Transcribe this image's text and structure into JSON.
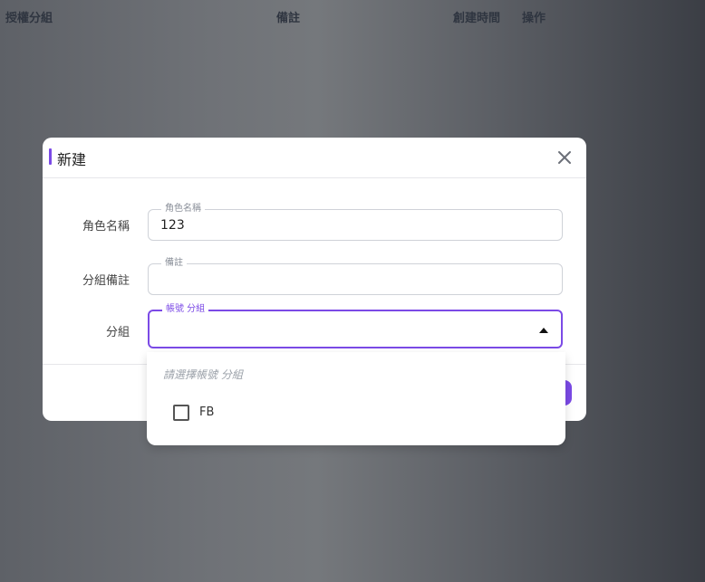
{
  "table_header": {
    "columns": [
      "授權分組",
      "備註",
      "創建時間",
      "操作"
    ]
  },
  "dialog": {
    "title": "新建",
    "fields": {
      "role_name": {
        "label": "角色名稱",
        "legend": "角色名稱",
        "value": "123"
      },
      "group_note": {
        "label": "分組備註",
        "legend": "備註",
        "value": ""
      },
      "group": {
        "label": "分組",
        "legend": "帳號 分組",
        "value": ""
      }
    }
  },
  "dropdown": {
    "placeholder": "請選擇帳號 分組",
    "options": [
      {
        "label": "FB",
        "checked": false
      }
    ]
  },
  "colors": {
    "accent": "#7b4ae6"
  },
  "icons": {
    "close": "close-icon",
    "arrow": "caret-up-icon",
    "checkbox": "checkbox-unchecked-icon"
  }
}
